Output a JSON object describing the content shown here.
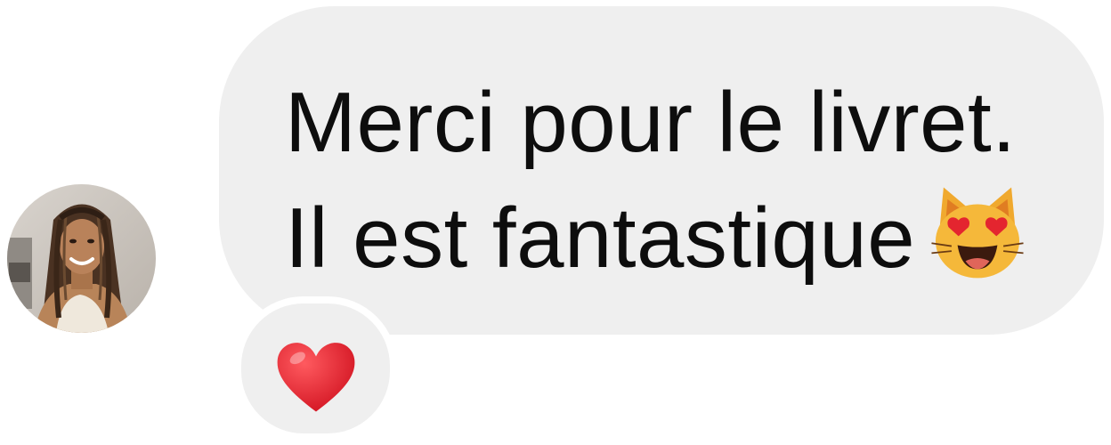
{
  "message": {
    "lines": [
      "Merci pour le livret.",
      "Il est fantastique"
    ],
    "emoji": "smiling-cat-heart-eyes-icon"
  },
  "sender": {
    "avatar": "avatar-photo"
  },
  "reaction": {
    "emoji": "red-heart-icon"
  },
  "colors": {
    "bubble_bg": "#efefef",
    "text": "#0d0d0d",
    "page_bg": "#ffffff",
    "heart": "#e0202e",
    "cat": "#f5b83a"
  }
}
